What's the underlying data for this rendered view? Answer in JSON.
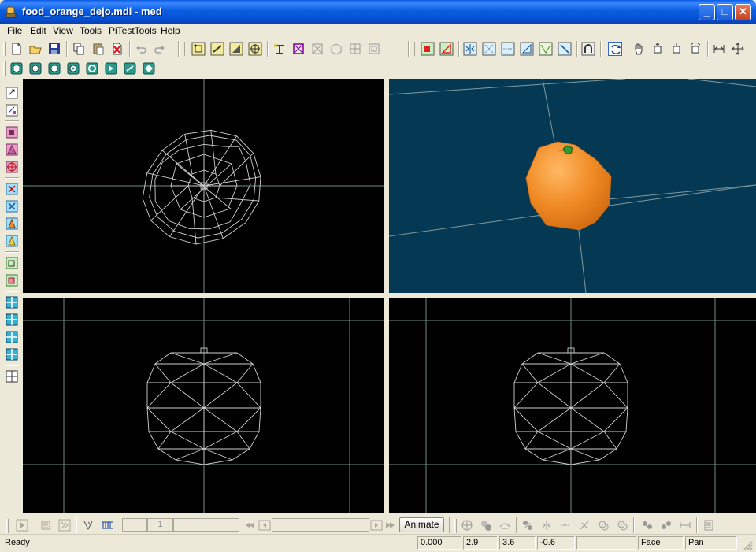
{
  "window": {
    "title": "food_orange_dejo.mdl - med",
    "minimize": "_",
    "maximize": "□",
    "close": "✕"
  },
  "menu": [
    {
      "key": "F",
      "rest": "ile"
    },
    {
      "key": "E",
      "rest": "dit"
    },
    {
      "key": "V",
      "rest": "iew"
    },
    {
      "key": "",
      "rest": "Tools"
    },
    {
      "key": "",
      "rest": "PiTestTools"
    },
    {
      "key": "H",
      "rest": "elp"
    }
  ],
  "timeline": {
    "frame_value": "1",
    "animate_label": "Animate"
  },
  "status": {
    "ready": "Ready",
    "coord_w": "0.000",
    "coord_x": "2.9",
    "coord_y": "3.6",
    "coord_z": "-0.6",
    "selection_mode": "Face",
    "navigation_mode": "Pan"
  },
  "colors": {
    "viewport_bg": "#000000",
    "perspective_bg": "#053953",
    "grid_line": "#6f8f7f",
    "wire": "#d0d0d0",
    "orange": "#f08a24",
    "stem": "#2e9b2e"
  }
}
